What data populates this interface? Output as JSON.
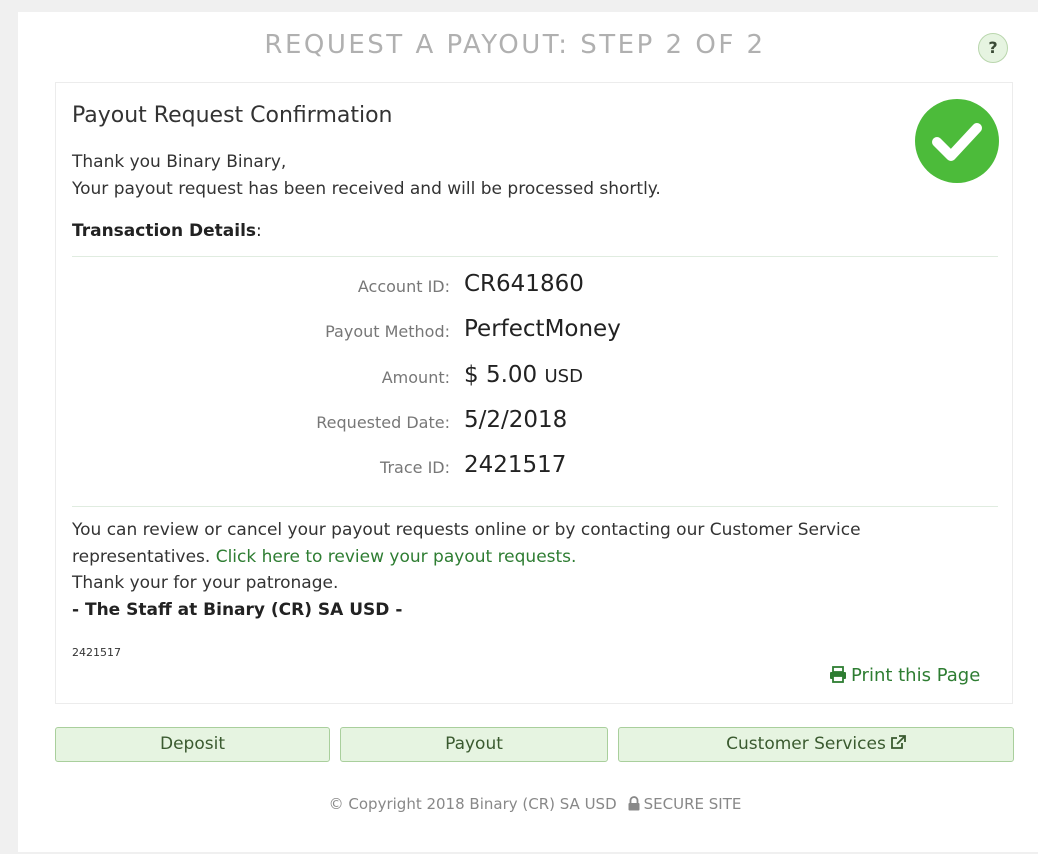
{
  "header": {
    "title": "REQUEST A PAYOUT: STEP 2 OF 2",
    "help_label": "?"
  },
  "confirmation": {
    "title": "Payout Request Confirmation",
    "greeting_line1": "Thank you Binary Binary,",
    "greeting_line2": "Your payout request has been received and will be processed shortly.",
    "details_heading": "Transaction Details",
    "details_colon": ":",
    "details": [
      {
        "label": "Account ID:",
        "value": "CR641860"
      },
      {
        "label": "Payout Method:",
        "value": "PerfectMoney"
      },
      {
        "label": "Amount:",
        "value": "$ 5.00",
        "unit": "USD"
      },
      {
        "label": "Requested Date:",
        "value": "5/2/2018"
      },
      {
        "label": "Trace ID:",
        "value": "2421517"
      }
    ],
    "review_text": "You can review or cancel your payout requests online or by contacting our Customer Service representatives.",
    "review_link": "Click here to review your payout requests.",
    "thanks": "Thank your for your patronage.",
    "signoff": "- The Staff at Binary (CR) SA USD -",
    "trace_small": "2421517",
    "print_label": "Print this Page"
  },
  "buttons": {
    "deposit": "Deposit",
    "payout": "Payout",
    "customer_services": "Customer Services"
  },
  "footer": {
    "copyright": "© Copyright 2018 Binary (CR) SA USD",
    "secure": "SECURE SITE"
  },
  "colors": {
    "success_green": "#4cbb3a",
    "link_green": "#2e7d32",
    "button_bg": "#e6f4e1"
  },
  "icons": [
    "check-circle-icon",
    "print-icon",
    "external-link-icon",
    "lock-icon",
    "help-icon"
  ]
}
